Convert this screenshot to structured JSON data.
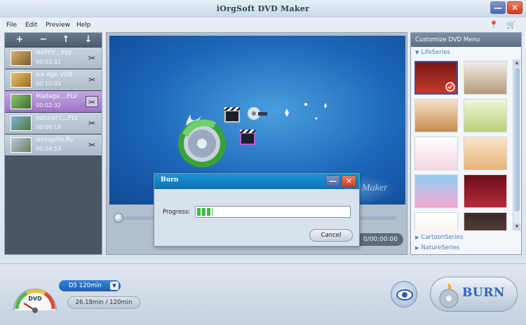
{
  "window": {
    "title": "iOrgSoft DVD Maker",
    "minimize_icon": "minimize-icon",
    "close_icon": "close-icon"
  },
  "menubar": {
    "items": [
      "File",
      "Edit",
      "Preview",
      "Help"
    ],
    "right_icons": [
      "pin-icon",
      "cart-icon"
    ]
  },
  "file_panel": {
    "toolbar": [
      "add-icon",
      "remove-icon",
      "move-up-icon",
      "move-down-icon"
    ],
    "files": [
      {
        "name": "HAPPY....FLV",
        "duration": "00:02:32",
        "selected": false
      },
      {
        "name": "Ice Age.VOB",
        "duration": "00:10:03",
        "selected": false
      },
      {
        "name": "Madaga....FLV",
        "duration": "00:02:32",
        "selected": true
      },
      {
        "name": "natural l....FLV",
        "duration": "00:06:18",
        "selected": false
      },
      {
        "name": "zixingche.flv",
        "duration": "00:04:53",
        "selected": false
      }
    ]
  },
  "preview": {
    "watermark": "Maker",
    "timecode": "0/00:00:00"
  },
  "menu_panel": {
    "header": "Customize DVD Menu",
    "series": [
      {
        "label": "LifeSeries",
        "expanded": true
      },
      {
        "label": "CartoonSeries",
        "expanded": false
      },
      {
        "label": "NatureSeries",
        "expanded": false
      }
    ]
  },
  "dialog": {
    "title": "Burn",
    "progress_label": "Progress:",
    "progress_value": 0.1,
    "cancel_label": "Cancel"
  },
  "bottom": {
    "gauge_label": "DVD",
    "disc_type": "D5 120min",
    "capacity": "26.18min / 120min",
    "preview_icon": "eye-icon",
    "burn_label": "BURN"
  },
  "colors": {
    "accent": "#1d7fc8",
    "progress": "#36c03a",
    "selected_row": "#a97fcf"
  }
}
